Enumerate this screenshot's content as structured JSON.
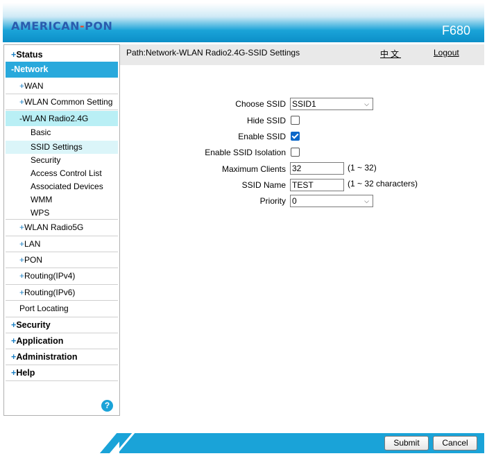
{
  "brand": {
    "logo_part1": "AMERICAN",
    "logo_dash": "-",
    "logo_part2": "PON",
    "model": "F680"
  },
  "sidebar": {
    "status": "Status",
    "network": "-Network",
    "wan": "WAN",
    "wlan_common": "WLAN Common Setting",
    "wlan24": "-WLAN Radio2.4G",
    "basic": "Basic",
    "ssid_settings": "SSID Settings",
    "security_leaf": "Security",
    "acl": "Access Control List",
    "associated": "Associated Devices",
    "wmm": "WMM",
    "wps": "WPS",
    "wlan5g": "WLAN Radio5G",
    "lan": "LAN",
    "pon": "PON",
    "routing4": "Routing(IPv4)",
    "routing6": "Routing(IPv6)",
    "port_locating": "Port Locating",
    "security": "Security",
    "application": "Application",
    "administration": "Administration",
    "help": "Help",
    "plus": "+",
    "help_icon": "?"
  },
  "pathbar": {
    "path": "Path:Network-WLAN Radio2.4G-SSID Settings",
    "lang": "中文",
    "logout": "Logout"
  },
  "form": {
    "choose_ssid_label": "Choose SSID",
    "choose_ssid_value": "SSID1",
    "hide_ssid_label": "Hide SSID",
    "hide_ssid_checked": false,
    "enable_ssid_label": "Enable SSID",
    "enable_ssid_checked": true,
    "isolation_label": "Enable SSID Isolation",
    "isolation_checked": false,
    "max_clients_label": "Maximum Clients",
    "max_clients_value": "32",
    "max_clients_hint": "(1 ~ 32)",
    "ssid_name_label": "SSID Name",
    "ssid_name_value": "TEST",
    "ssid_name_hint": "(1 ~ 32 characters)",
    "priority_label": "Priority",
    "priority_value": "0"
  },
  "footer": {
    "submit": "Submit",
    "cancel": "Cancel"
  },
  "icons": {
    "dropdown": "chevron-down-icon",
    "help": "help-icon"
  }
}
